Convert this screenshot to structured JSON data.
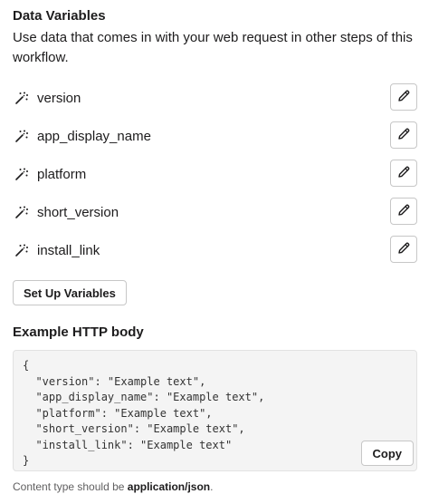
{
  "data_variables": {
    "title": "Data Variables",
    "description": "Use data that comes in with your web request in other steps of this workflow.",
    "variable_icon": "magic-wand-icon",
    "edit_icon": "pencil-icon",
    "items": [
      {
        "label": "version"
      },
      {
        "label": "app_display_name"
      },
      {
        "label": "platform"
      },
      {
        "label": "short_version"
      },
      {
        "label": "install_link"
      }
    ],
    "setup_button_label": "Set Up Variables"
  },
  "example": {
    "title": "Example HTTP body",
    "code": "{\n  \"version\": \"Example text\",\n  \"app_display_name\": \"Example text\",\n  \"platform\": \"Example text\",\n  \"short_version\": \"Example text\",\n  \"install_link\": \"Example text\"\n}",
    "copy_button_label": "Copy"
  },
  "footnote": {
    "prefix": "Content type should be ",
    "content_type": "application/json",
    "suffix": "."
  }
}
